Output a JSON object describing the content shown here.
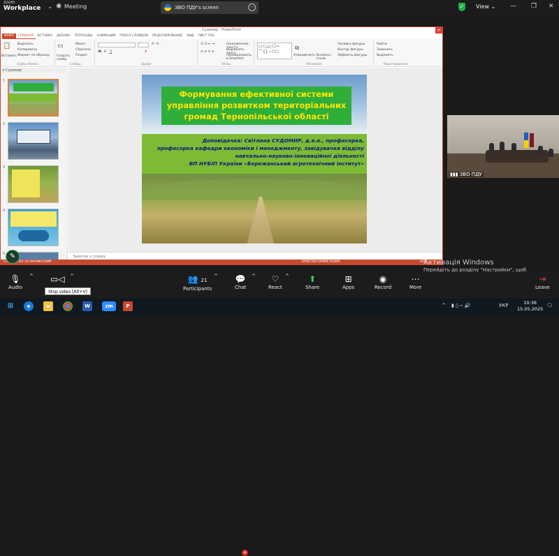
{
  "zoom": {
    "brand_small": "zoom",
    "brand": "Workplace",
    "meeting_label": "Meeting",
    "share_label": "ЗВО ПДУ's screen",
    "view_label": "View",
    "bottom_buttons": [
      {
        "id": "audio",
        "label": "Audio",
        "icon": "mic-icon"
      },
      {
        "id": "video",
        "label": "Stop video",
        "icon": "video-icon"
      },
      {
        "id": "participants",
        "label": "Participants",
        "count": "21",
        "icon": "participants-icon"
      },
      {
        "id": "chat",
        "label": "Chat",
        "badge": "4",
        "icon": "chat-icon"
      },
      {
        "id": "react",
        "label": "React",
        "icon": "heart-icon"
      },
      {
        "id": "share",
        "label": "Share",
        "icon": "share-icon"
      },
      {
        "id": "apps",
        "label": "Apps",
        "icon": "apps-icon"
      },
      {
        "id": "record",
        "label": "Record",
        "icon": "record-icon"
      },
      {
        "id": "more",
        "label": "More",
        "icon": "more-icon"
      },
      {
        "id": "leave",
        "label": "Leave",
        "icon": "leave-icon"
      }
    ],
    "tooltip": "Stop video [Alt+V]",
    "video_tile_label": "ЗВО ПДУ"
  },
  "powerpoint": {
    "window_title": "Судомир - PowerPoint",
    "tabs": [
      "ФАЙЛ",
      "ГЛАВНАЯ",
      "ВСТАВКА",
      "ДИЗАЙН",
      "ПЕРЕХОДЫ",
      "АНИМАЦИЯ",
      "ПОКАЗ СЛАЙДОВ",
      "РЕЦЕНЗИРОВАНИЕ",
      "ВИД",
      "ЛИСТ ТАБ"
    ],
    "ribbon_groups": [
      "Буфер обмена",
      "Слайды",
      "Шрифт",
      "Абзац",
      "Рисование",
      "Редактирование"
    ],
    "ribbon_buttons": {
      "paste": "Вставить",
      "new_slide": "Создать слайд",
      "layout": "Макет",
      "reset": "Сбросить",
      "section": "Раздел",
      "cut": "Вырезать",
      "copy": "Копировать",
      "format": "Формат по образцу",
      "arrange": "Упорядочить",
      "quick_styles": "Экспресс-стили",
      "find": "Найти",
      "replace": "Заменить",
      "select": "Выделить",
      "text_direction": "Направление текста",
      "align_text": "Выровнять текст",
      "smartart": "Преобразовать в SmartArt",
      "shape_fill": "Заливка фигуры",
      "shape_outline": "Контур фигуры",
      "shape_effects": "Эффекты фигуры"
    },
    "panel_heading": "Судомир",
    "slide_numbers": [
      "1",
      "2",
      "3",
      "4",
      "5"
    ],
    "notes_placeholder": "Заметки к слайду",
    "status_text": "СЛАЙД 1 ИЗ 16   УКРАИНСКИЙ",
    "status_right": "ЗАМЕТКИ   ПРИМЕЧАНИЯ",
    "zoom_level": "40%"
  },
  "slide": {
    "title": "Формування ефективної системи управління розвитком територіальних громад Тернопільської області",
    "speaker_lines": [
      "Доповідачка: Світлана СУДОМИР, д.е.н., професорка,",
      "професорка кафедри економіки і менеджменту, завідувачка відділу",
      "навчально-науково-інноваційної діяльності",
      "ВП НУБіП України «Бережанський агротехнічний інститут»"
    ]
  },
  "windows_activation": {
    "title": "Активація Windows",
    "subtitle": "Перейдіть до розділу \"Настройки\", щоб активувати Windows."
  },
  "taskbar": {
    "icons": [
      "windows-icon",
      "edge-icon",
      "explorer-icon",
      "chrome-icon",
      "word-icon",
      "zoom-icon",
      "powerpoint-icon"
    ],
    "lang": "УКР",
    "time": "10:36",
    "date": "15.05.2025"
  },
  "colors": {
    "slide_title_bg": "#2fae3a",
    "slide_title_text": "#ffe600",
    "speaker_bg": "#7dbb34",
    "speaker_text": "#0a1a80",
    "ppt_accent": "#c84a2e"
  }
}
